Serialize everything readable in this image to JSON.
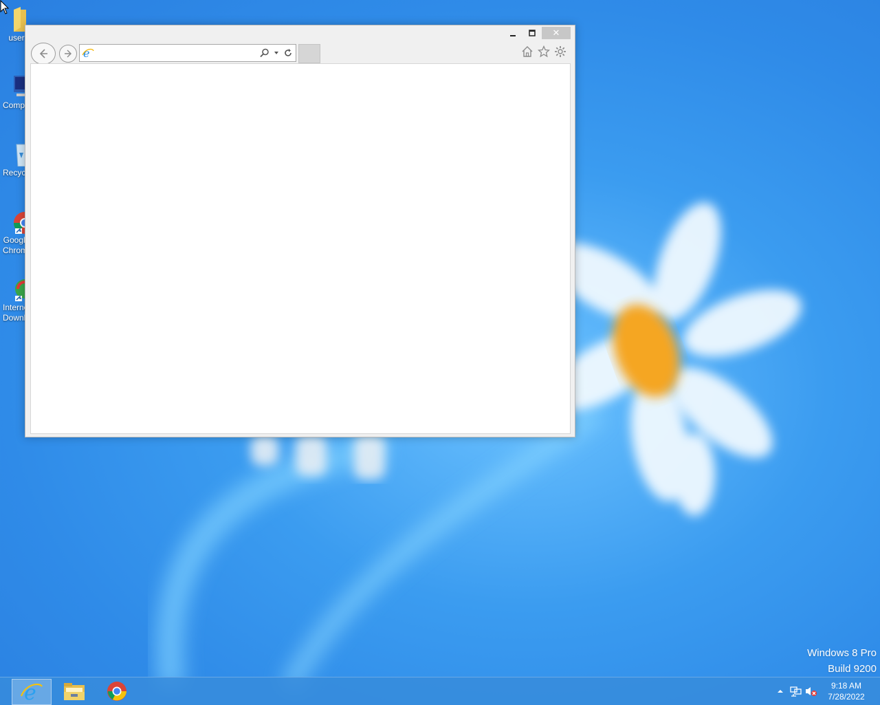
{
  "desktop": {
    "icons": [
      {
        "label": "user"
      },
      {
        "label": "Computer"
      },
      {
        "label": "Recycle Bin"
      },
      {
        "label": "Google\nChrome"
      },
      {
        "label": "Internet\nDownload..."
      }
    ],
    "watermark": {
      "line1": "Windows 8 Pro",
      "line2": "Build 9200"
    }
  },
  "ie_window": {
    "address": {
      "value": "",
      "placeholder": ""
    },
    "caption": {
      "minimize": "–",
      "maximize": "□",
      "close": "✕"
    }
  },
  "taskbar": {
    "pinned": [
      "internet-explorer-icon",
      "file-explorer-icon",
      "chrome-icon"
    ],
    "clock": {
      "time": "9:18 AM",
      "date": "7/28/2022"
    }
  },
  "colors": {
    "accent": "#2f8be8",
    "taskbar": "#378cdc"
  }
}
